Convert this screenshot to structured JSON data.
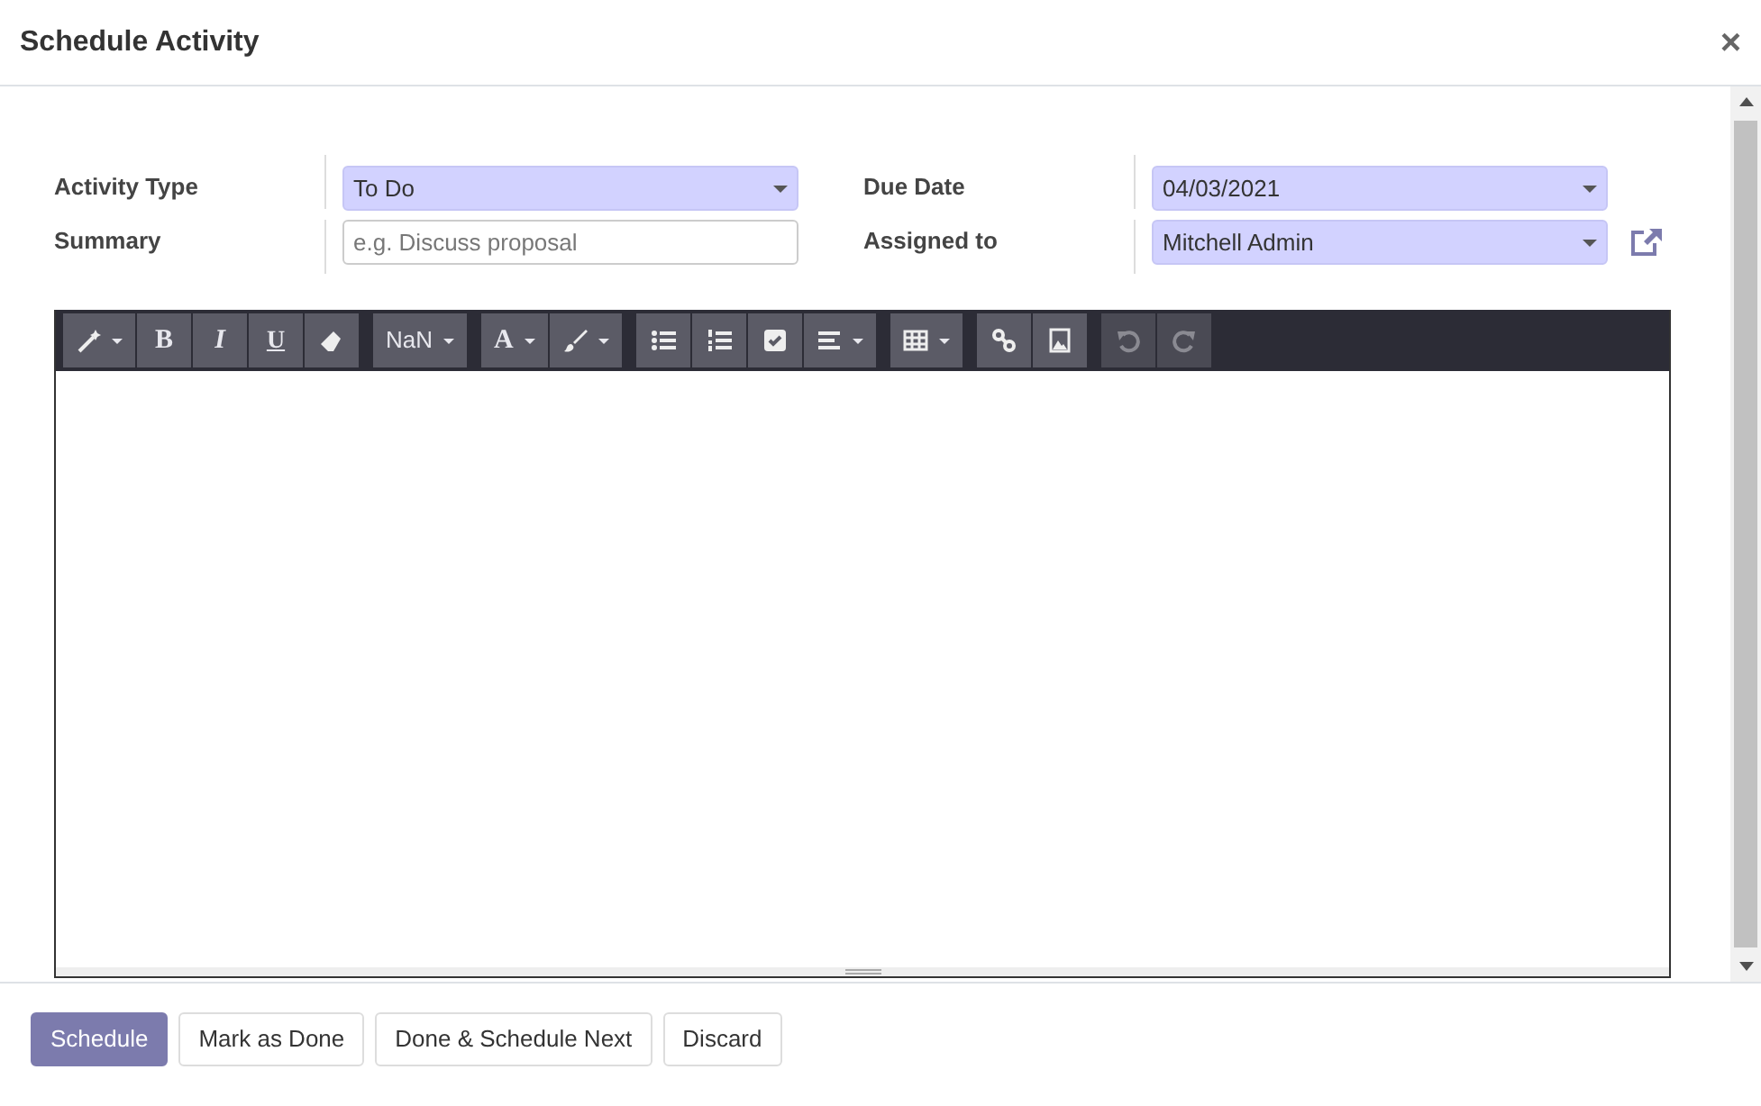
{
  "window": {
    "title": "Schedule Activity",
    "close": "×"
  },
  "fields": [
    {
      "label": "Activity Type",
      "kind": "select",
      "value": "To Do",
      "highlighted": true
    },
    {
      "label": "Summary",
      "kind": "text",
      "placeholder": "e.g. Discuss proposal",
      "highlighted": false
    },
    {
      "label": "Due Date",
      "kind": "select",
      "value": "04/03/2021",
      "highlighted": true
    },
    {
      "label": "Assigned to",
      "kind": "select",
      "value": "Mitchell Admin",
      "highlighted": true,
      "external_link": true
    }
  ],
  "toolbar": {
    "groups": [
      {
        "items": [
          {
            "kind": "wand",
            "caret": true,
            "disabled": false
          },
          {
            "kind": "bold",
            "label": "B",
            "caret": false,
            "disabled": false
          },
          {
            "kind": "italic",
            "label": "I",
            "caret": false,
            "disabled": false
          },
          {
            "kind": "underline",
            "label": "U",
            "caret": false,
            "disabled": false
          },
          {
            "kind": "eraser",
            "caret": false,
            "disabled": false
          }
        ]
      },
      {
        "items": [
          {
            "kind": "text",
            "label": "NaN",
            "caret": true,
            "disabled": false
          }
        ]
      },
      {
        "items": [
          {
            "kind": "bold",
            "label": "A",
            "caret": true,
            "disabled": false
          },
          {
            "kind": "brush",
            "caret": true,
            "disabled": false
          }
        ]
      },
      {
        "items": [
          {
            "kind": "bullets",
            "caret": false,
            "disabled": false
          },
          {
            "kind": "numbers",
            "caret": false,
            "disabled": false
          },
          {
            "kind": "checkbox",
            "caret": false,
            "disabled": false
          },
          {
            "kind": "align",
            "caret": true,
            "disabled": false
          }
        ]
      },
      {
        "items": [
          {
            "kind": "table",
            "caret": true,
            "disabled": false
          }
        ]
      },
      {
        "items": [
          {
            "kind": "link",
            "caret": false,
            "disabled": false
          },
          {
            "kind": "image",
            "caret": false,
            "disabled": false
          }
        ]
      },
      {
        "items": [
          {
            "kind": "undo",
            "caret": false,
            "disabled": true
          },
          {
            "kind": "redo",
            "caret": false,
            "disabled": true
          }
        ]
      }
    ]
  },
  "buttons": [
    {
      "label": "Schedule",
      "primary": true
    },
    {
      "label": "Mark as Done",
      "primary": false
    },
    {
      "label": "Done & Schedule Next",
      "primary": false
    },
    {
      "label": "Discard",
      "primary": false
    }
  ]
}
